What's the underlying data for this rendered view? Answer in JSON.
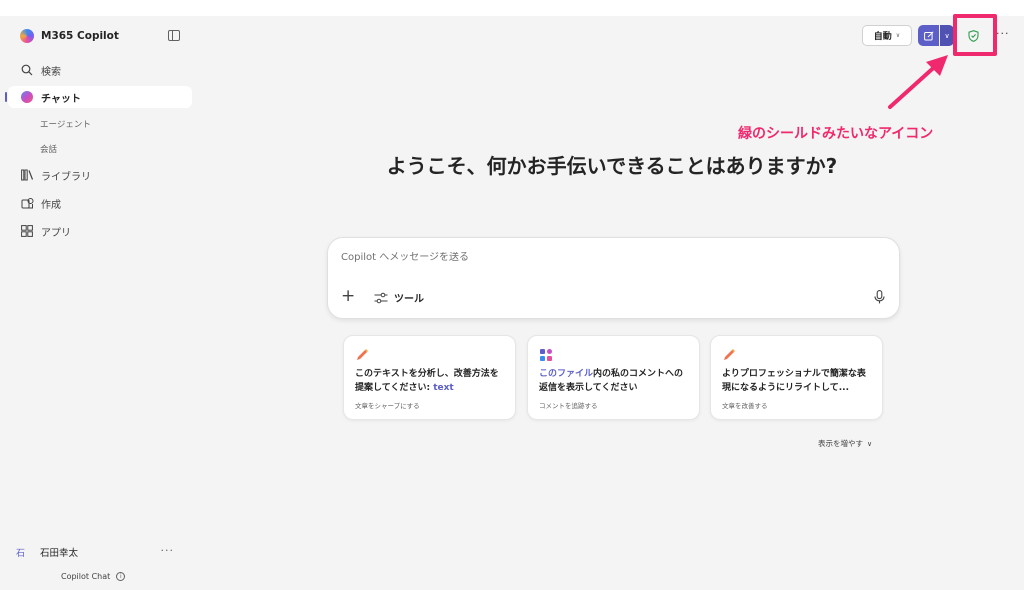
{
  "brand": {
    "title": "M365 Copilot"
  },
  "sidebar": {
    "search": "検索",
    "chat": "チャット",
    "sub_items": [
      "エージェント",
      "会話"
    ],
    "library": "ライブラリ",
    "create": "作成",
    "apps": "アプリ"
  },
  "user": {
    "avatar": "石",
    "name": "石田幸太",
    "more": "···"
  },
  "footer": {
    "label": "Copilot Chat"
  },
  "topbar": {
    "mode": "自動",
    "more": "···"
  },
  "annotation": {
    "text": "緑のシールドみたいなアイコン",
    "color": "#f0286e"
  },
  "welcome": "ようこそ、何かお手伝いできることはありますか?",
  "composer": {
    "placeholder": "Copilot へメッセージを送る",
    "tools_label": "ツール"
  },
  "cards": [
    {
      "icon": "pencil-icon",
      "text_pre": "このテキストを分析し、改善方法を提案してください: ",
      "text_accent": "text",
      "text_post": "",
      "sub": "文章をシャープにする"
    },
    {
      "icon": "apps-icon",
      "text_pre": "",
      "text_accent": "このファイル",
      "text_post": "内の私のコメントへの返信を表示してください",
      "sub": "コメントを追跡する"
    },
    {
      "icon": "pencil-icon",
      "text_pre": "よりプロフェッショナルで簡潔な表現になるようにリライトして...",
      "text_accent": "",
      "text_post": "",
      "sub": "文章を改善する"
    }
  ],
  "show_more": "表示を増やす",
  "colors": {
    "accent": "#5b5fc7",
    "shield": "#2e9e4f",
    "highlight": "#f0286e"
  }
}
